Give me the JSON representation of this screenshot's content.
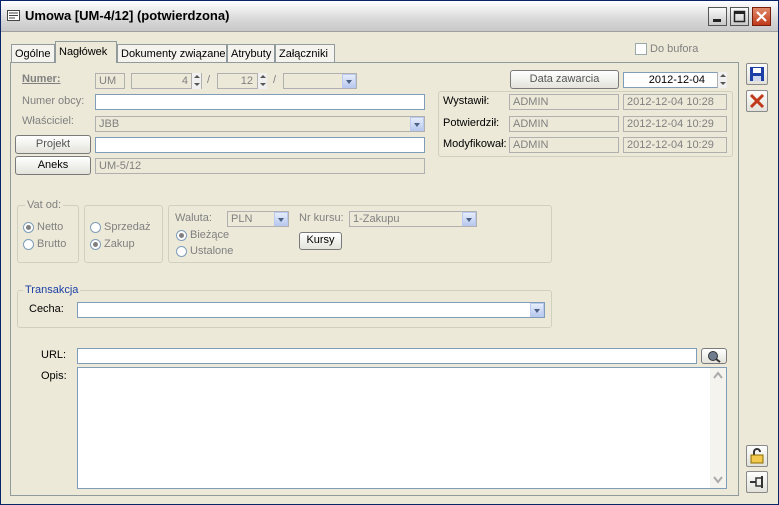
{
  "window": {
    "title": "Umowa [UM-4/12]  (potwierdzona)"
  },
  "tabs": [
    {
      "label": "Ogólne"
    },
    {
      "label": "Nagłówek"
    },
    {
      "label": "Dokumenty związane"
    },
    {
      "label": "Atrybuty"
    },
    {
      "label": "Załączniki"
    }
  ],
  "do_bufora": {
    "label": "Do bufora",
    "checked": false
  },
  "numer": {
    "label": "Numer:",
    "prefix": "UM",
    "number": "4",
    "year": "12",
    "sep1": "/",
    "sep2": "/",
    "suffix": ""
  },
  "data_zawarcia": {
    "button": "Data zawarcia",
    "value": "2012-12-04"
  },
  "numer_obcy": {
    "label": "Numer obcy:",
    "value": ""
  },
  "wlasciciel": {
    "label": "Właściciel:",
    "value": "JBB"
  },
  "projekt": {
    "button": "Projekt",
    "value": ""
  },
  "aneks": {
    "button": "Aneks",
    "value": "UM-5/12"
  },
  "audit": {
    "wystawil": {
      "label": "Wystawił:",
      "user": "ADMIN",
      "date": "2012-12-04 10:28"
    },
    "potwierdzil": {
      "label": "Potwierdził:",
      "user": "ADMIN",
      "date": "2012-12-04 10:29"
    },
    "modyfikowal": {
      "label": "Modyfikował:",
      "user": "ADMIN",
      "date": "2012-12-04 10:29"
    }
  },
  "vat": {
    "legend": "Vat od:",
    "netto": "Netto",
    "brutto": "Brutto",
    "selected": "Netto"
  },
  "kierunek": {
    "sprzedaz": "Sprzedaż",
    "zakup": "Zakup",
    "selected": "Zakup"
  },
  "waluta": {
    "label": "Waluta:",
    "value": "PLN",
    "biezace": "Bieżące",
    "ustalone": "Ustalone",
    "selected": "Bieżące"
  },
  "kurs": {
    "label": "Nr kursu:",
    "value": "1-Zakupu",
    "button": "Kursy"
  },
  "transakcja": {
    "legend": "Transakcja",
    "cecha_label": "Cecha:",
    "cecha_value": ""
  },
  "url": {
    "label": "URL:",
    "value": ""
  },
  "opis": {
    "label": "Opis:",
    "value": ""
  },
  "colors": {
    "accent": "#1c3fa5",
    "window_bg": "#ece9d8",
    "close_red": "#c0391b"
  }
}
